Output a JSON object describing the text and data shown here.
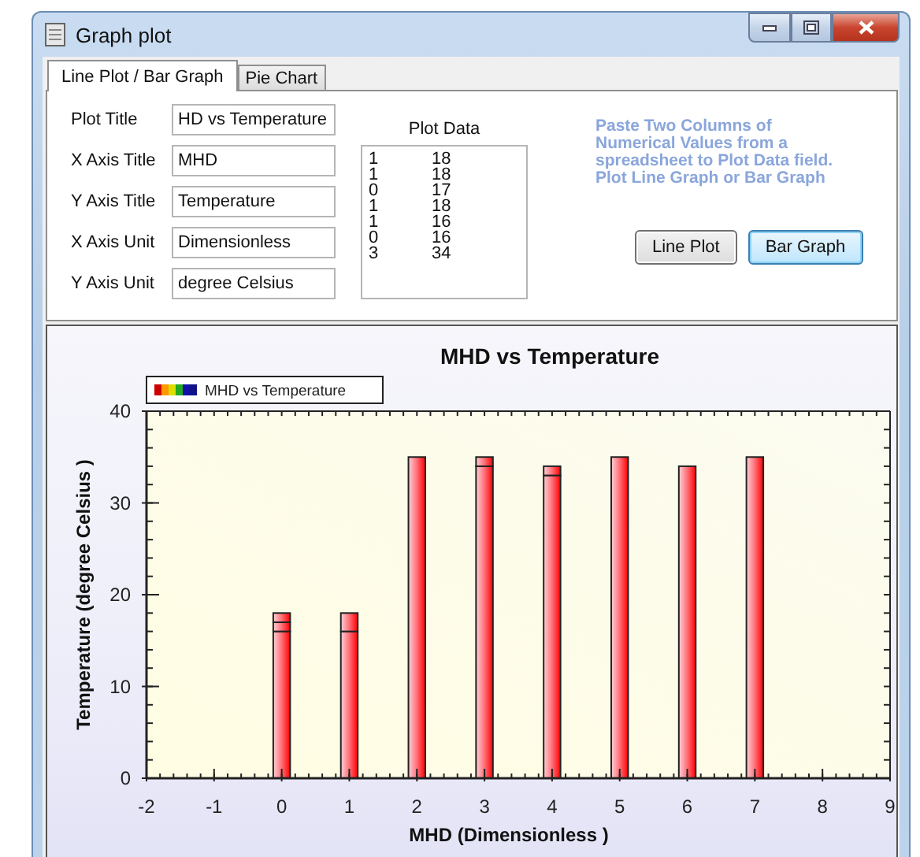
{
  "window": {
    "title": "Graph plot"
  },
  "tabs": [
    {
      "label": "Line Plot / Bar Graph",
      "selected": true
    },
    {
      "label": "Pie Chart",
      "selected": false
    }
  ],
  "form": {
    "fields": [
      {
        "label": "Plot Title",
        "value": "HD vs Temperature"
      },
      {
        "label": "X Axis Title",
        "value": "MHD"
      },
      {
        "label": "Y Axis Title",
        "value": "Temperature"
      },
      {
        "label": "X Axis Unit",
        "value": "Dimensionless"
      },
      {
        "label": "Y Axis Unit",
        "value": "degree Celsius"
      }
    ],
    "plot_data": {
      "label": "Plot Data",
      "rows": [
        [
          "1",
          "18"
        ],
        [
          "1",
          "18"
        ],
        [
          "0",
          "17"
        ],
        [
          "1",
          "18"
        ],
        [
          "1",
          "16"
        ],
        [
          "0",
          "16"
        ],
        [
          "3",
          "34"
        ]
      ]
    },
    "hint": "Paste Two Columns of Numerical Values from a spreadsheet to Plot Data field. Plot Line Graph or Bar Graph",
    "buttons": [
      {
        "label": "Line Plot",
        "focused": false
      },
      {
        "label": "Bar Graph",
        "focused": true
      }
    ]
  },
  "chart": {
    "chart_data": {
      "type": "bar",
      "title": "MHD vs Temperature",
      "xlabel": "MHD (Dimensionless )",
      "ylabel": "Temperature (degree Celsius )",
      "x": [
        0,
        1,
        2,
        3,
        4,
        5,
        6,
        7
      ],
      "series": [
        {
          "name": "MHD vs Temperature",
          "values": [
            16,
            16,
            35,
            34,
            33,
            35,
            34,
            35
          ]
        },
        {
          "values": [
            1,
            2,
            null,
            1,
            1,
            null,
            null,
            null
          ]
        },
        {
          "values": [
            1,
            null,
            null,
            null,
            null,
            null,
            null,
            null
          ]
        }
      ],
      "stacked": true,
      "xlim": [
        -2,
        9
      ],
      "ylim": [
        0,
        40
      ],
      "xticks": [
        -2,
        -1,
        0,
        1,
        2,
        3,
        4,
        5,
        6,
        7,
        8,
        9
      ],
      "yticks": [
        0,
        10,
        20,
        30,
        40
      ]
    }
  }
}
